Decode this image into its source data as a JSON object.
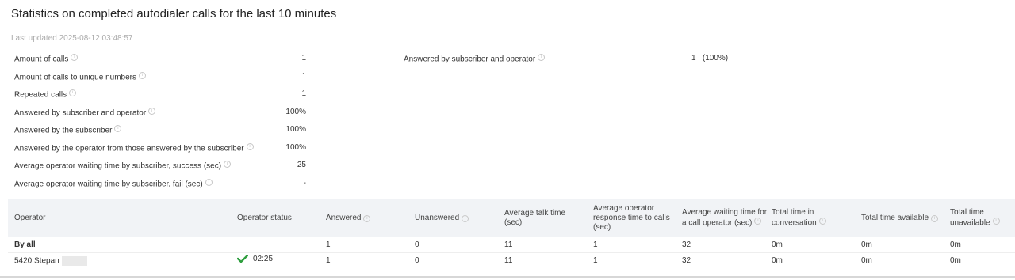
{
  "page": {
    "title": "Statistics on completed autodialer calls for the last 10 minutes",
    "last_updated": "Last updated 2025-08-12 03:48:57"
  },
  "stats_left": [
    {
      "label": "Amount of calls",
      "value": "1",
      "info": true
    },
    {
      "label": "Amount of calls to unique numbers",
      "value": "1",
      "info": true
    },
    {
      "label": "Repeated calls",
      "value": "1",
      "info": true
    },
    {
      "label": "Answered by subscriber and operator",
      "value": "100%",
      "info": true
    },
    {
      "label": "Answered by the subscriber",
      "value": "100%",
      "info": true
    },
    {
      "label": "Answered by the operator from those answered by the subscriber",
      "value": "100%",
      "info": true
    },
    {
      "label": "Average operator waiting time by subscriber, success (sec)",
      "value": "25",
      "info": true
    },
    {
      "label": "Average operator waiting time by subscriber, fail (sec)",
      "value": "-",
      "info": true
    }
  ],
  "stats_right": {
    "label": "Answered by subscriber and operator",
    "value": "1   (100%)"
  },
  "info_icon": "i",
  "table": {
    "columns": [
      {
        "label": "Operator",
        "info": false
      },
      {
        "label": "Operator status",
        "info": false
      },
      {
        "label": "Answered",
        "info": true
      },
      {
        "label": "Unanswered",
        "info": true
      },
      {
        "label": "Average talk time (sec)",
        "info": false
      },
      {
        "label": "Average operator response time to calls (sec)",
        "info": false
      },
      {
        "label": "Average waiting time for a call operator (sec)",
        "info": true
      },
      {
        "label": "Total time in conversation",
        "info": true
      },
      {
        "label": "Total time available",
        "info": true
      },
      {
        "label": "Total time unavailable",
        "info": true
      }
    ],
    "rows": [
      {
        "operator": "By all",
        "status": "",
        "answered": "1",
        "unanswered": "0",
        "avg_talk": "11",
        "avg_response": "1",
        "avg_wait": "32",
        "total_conv": "0m",
        "total_avail": "0m",
        "total_unavail": "0m"
      },
      {
        "operator": "5420 Stepan",
        "status": "02:25",
        "answered": "1",
        "unanswered": "0",
        "avg_talk": "11",
        "avg_response": "1",
        "avg_wait": "32",
        "total_conv": "0m",
        "total_avail": "0m",
        "total_unavail": "0m"
      }
    ]
  },
  "colors": {
    "check": "#2e9e3e",
    "header_bg": "#f1f3f6"
  }
}
